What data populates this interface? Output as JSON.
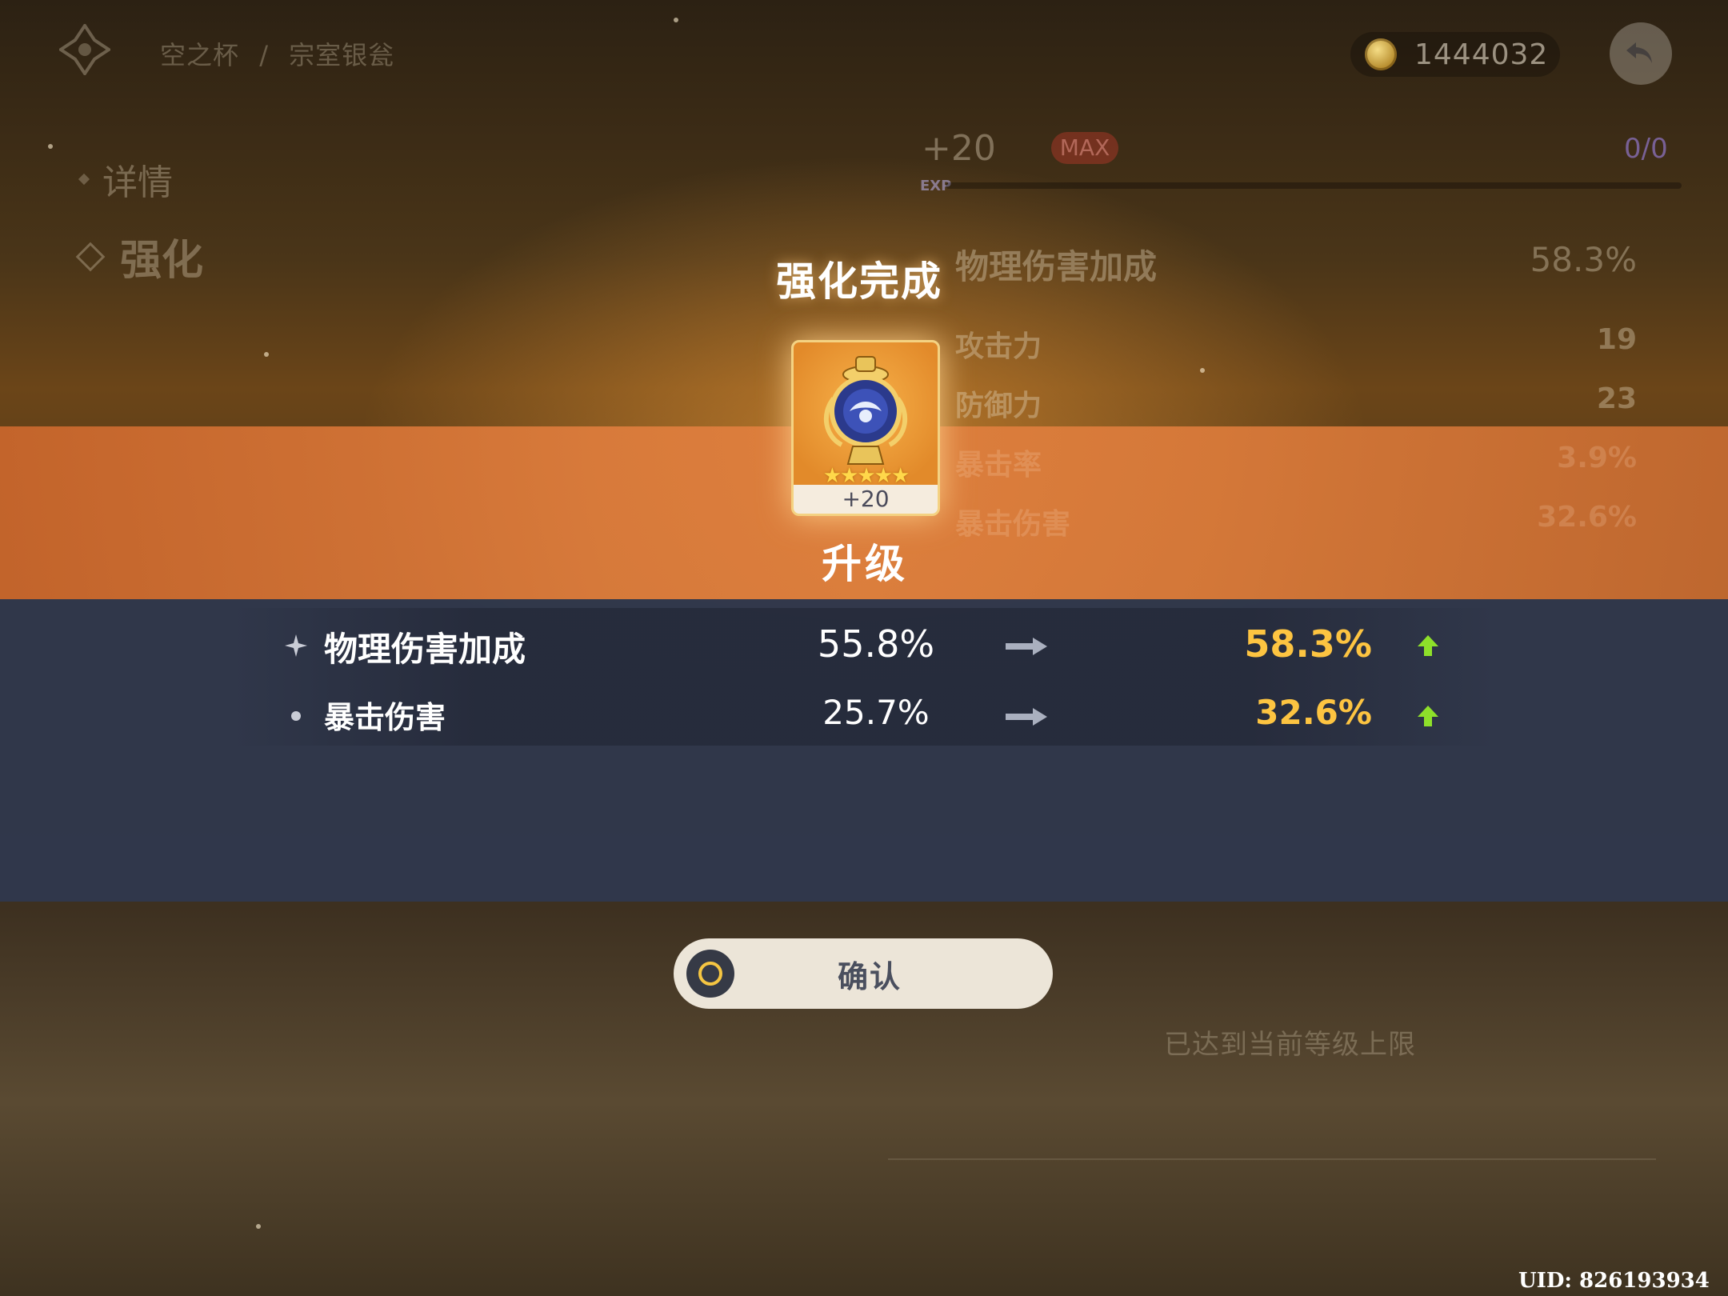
{
  "breadcrumb": {
    "category": "空之杯",
    "separator": "/",
    "item": "宗室银瓮"
  },
  "currency": {
    "icon": "mora-coin-icon",
    "amount": "1444032"
  },
  "nav": {
    "details": "详情",
    "enhance": "强化"
  },
  "background_panel": {
    "level": "+20",
    "max_badge": "MAX",
    "exp_label": "EXP",
    "exp_ratio": "0/0",
    "main_stat": {
      "name": "物理伤害加成",
      "value": "58.3%"
    },
    "sub_stats": [
      {
        "name": "攻击力",
        "value": "19"
      },
      {
        "name": "防御力",
        "value": "23"
      },
      {
        "name": "暴击率",
        "value": "3.9%"
      },
      {
        "name": "暴击伤害",
        "value": "32.6%"
      }
    ],
    "limit_text": "已达到当前等级上限"
  },
  "dialog": {
    "title": "强化完成",
    "artifact": {
      "level": "+20",
      "stars": "★★★★★",
      "rarity": 5
    },
    "subtitle": "升级",
    "changes": [
      {
        "name": "物理伤害加成",
        "old": "55.8%",
        "new": "58.3%"
      },
      {
        "name": "暴击伤害",
        "old": "25.7%",
        "new": "32.6%"
      }
    ],
    "confirm_label": "确认"
  },
  "uid": "UID: 826193934",
  "colors": {
    "accent_orange": "#dc7c3c",
    "panel_navy": "#30384c",
    "value_gold": "#fdc441",
    "up_green": "#8ee02a"
  }
}
